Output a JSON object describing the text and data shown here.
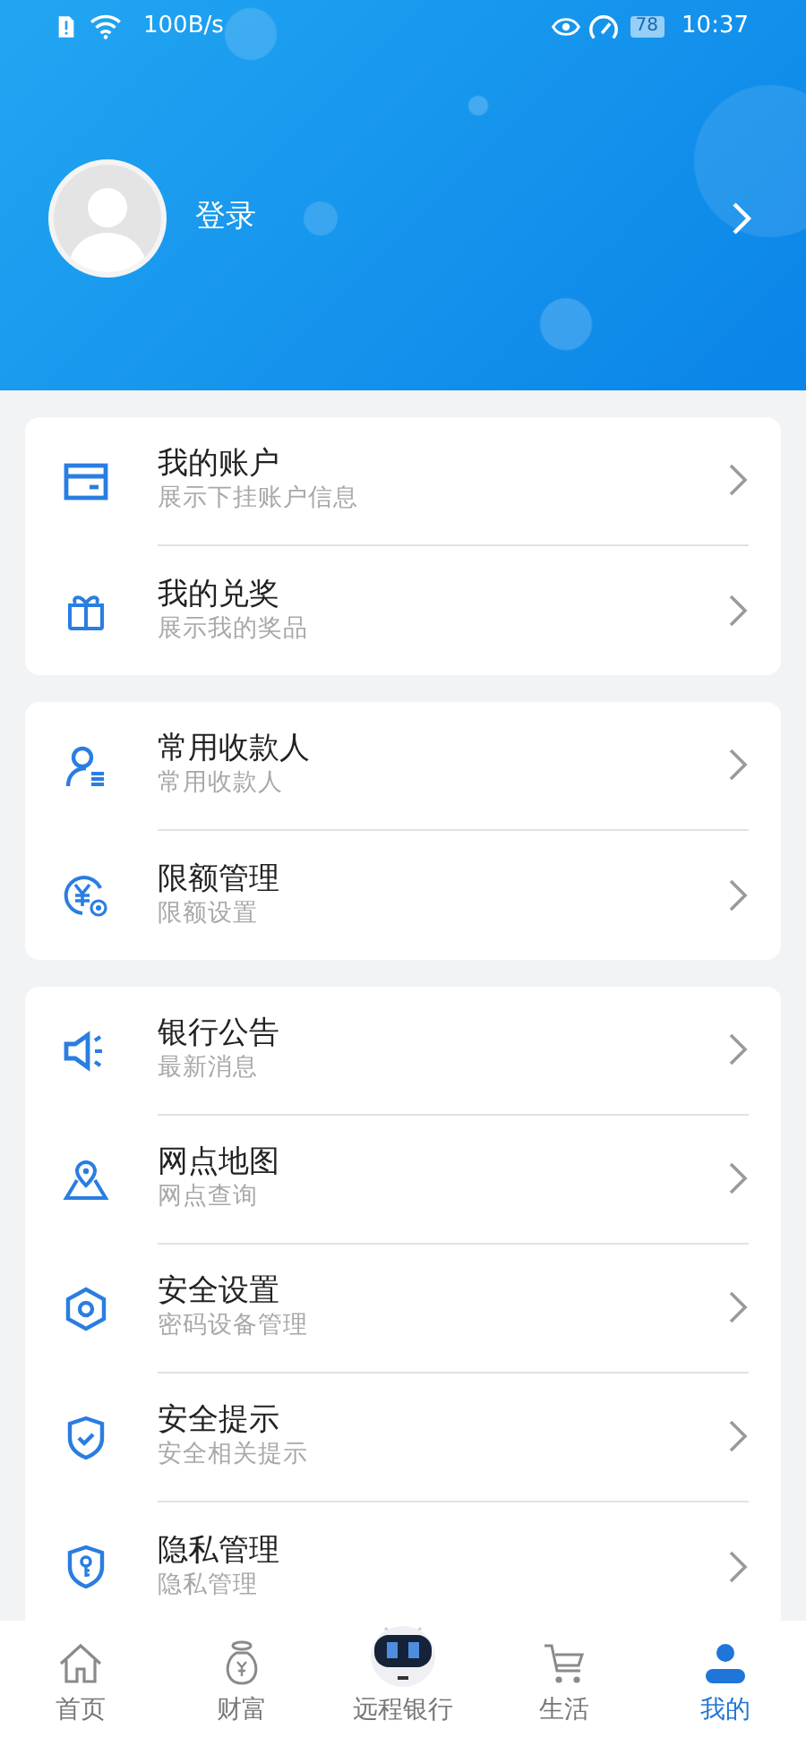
{
  "status_bar": {
    "network_speed": "100B/s",
    "battery": "78",
    "time": "10:37"
  },
  "profile": {
    "login": "登录"
  },
  "groups": [
    [
      {
        "title": "我的账户",
        "subtitle": "展示下挂账户信息"
      },
      {
        "title": "我的兑奖",
        "subtitle": "展示我的奖品"
      }
    ],
    [
      {
        "title": "常用收款人",
        "subtitle": "常用收款人"
      },
      {
        "title": "限额管理",
        "subtitle": "限额设置"
      }
    ],
    [
      {
        "title": "银行公告",
        "subtitle": "最新消息"
      },
      {
        "title": "网点地图",
        "subtitle": "网点查询"
      },
      {
        "title": "安全设置",
        "subtitle": "密码设备管理"
      },
      {
        "title": "安全提示",
        "subtitle": "安全相关提示"
      },
      {
        "title": "隐私管理",
        "subtitle": "隐私管理"
      }
    ]
  ],
  "tab_bar": [
    {
      "label": "首页",
      "selected": false
    },
    {
      "label": "财富",
      "selected": false
    },
    {
      "label": "远程银行",
      "selected": false
    },
    {
      "label": "生活",
      "selected": false
    },
    {
      "label": "我的",
      "selected": true
    }
  ]
}
